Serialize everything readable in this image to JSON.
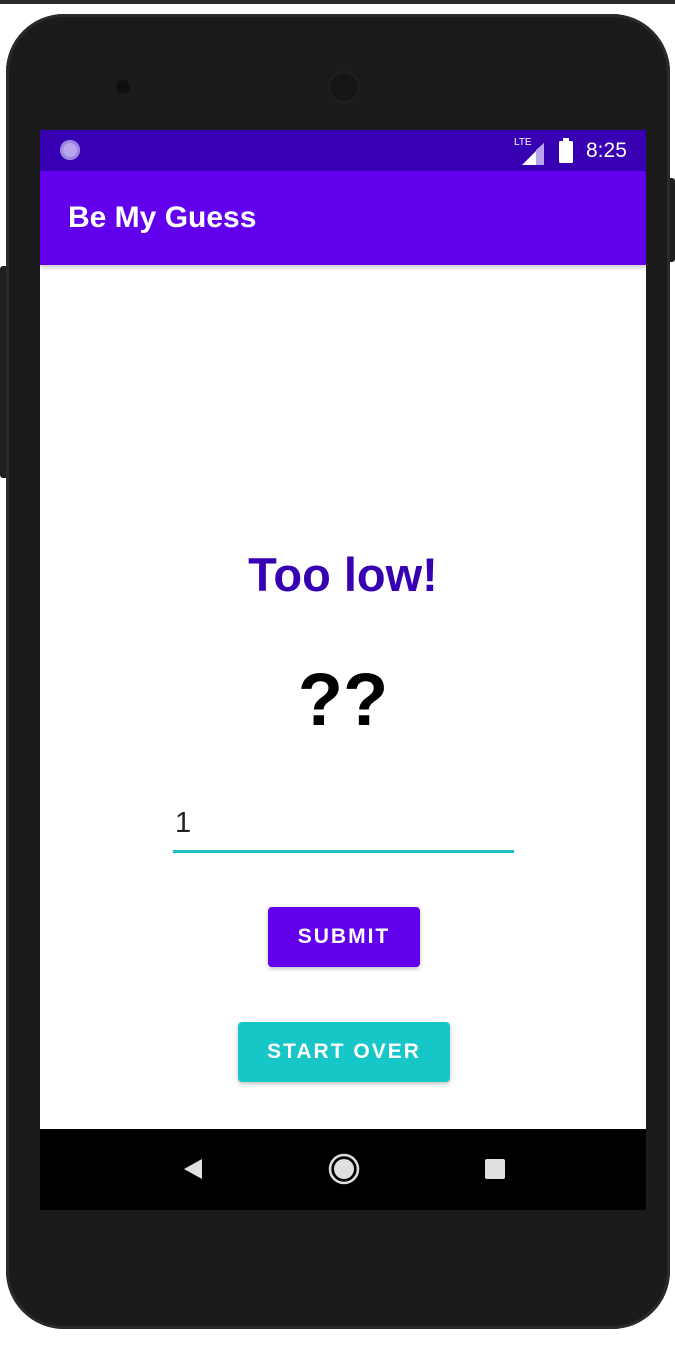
{
  "status_bar": {
    "network_label": "LTE",
    "time": "8:25"
  },
  "app_bar": {
    "title": "Be My Guess"
  },
  "game": {
    "result_message": "Too low!",
    "secret_number": "??",
    "guess_value": "1",
    "submit_label": "SUBMIT",
    "start_over_label": "START OVER"
  },
  "colors": {
    "primary": "#6200ee",
    "primary_dark": "#3700b3",
    "accent": "#17c6c6"
  },
  "icons": {
    "status_left": "notification-circle-icon",
    "network": "lte-signal-icon",
    "battery": "battery-icon",
    "nav_back": "back-triangle-icon",
    "nav_home": "home-circle-icon",
    "nav_recents": "recents-square-icon"
  }
}
